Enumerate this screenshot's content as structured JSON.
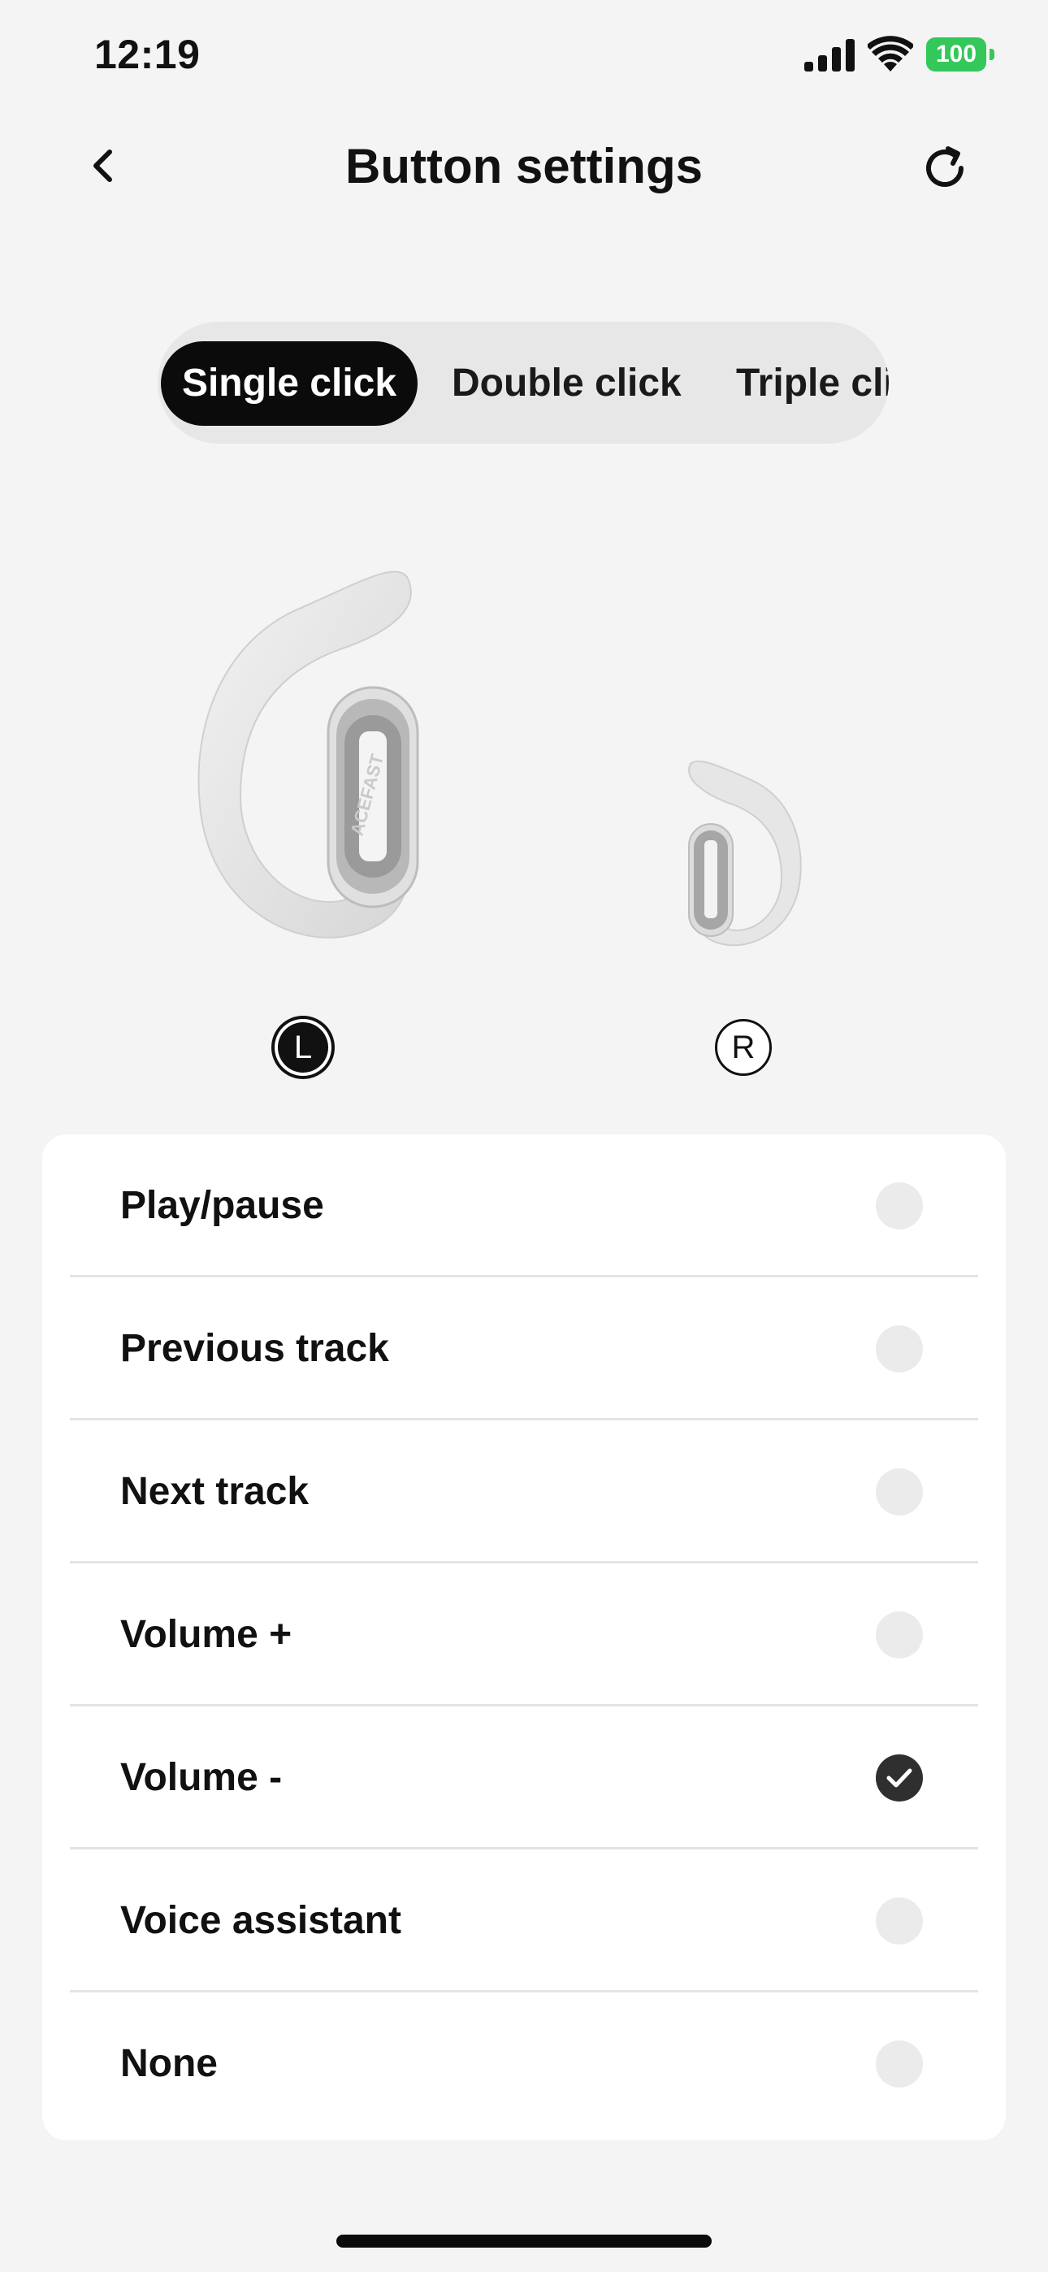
{
  "status_bar": {
    "time": "12:19",
    "battery_level": "100",
    "battery_color": "#34c759",
    "icons": [
      "signal-icon",
      "wifi-icon",
      "battery-icon"
    ]
  },
  "header": {
    "title": "Button settings",
    "back_icon": "chevron-left-icon",
    "refresh_icon": "refresh-icon"
  },
  "tabs": [
    {
      "label": "Single click",
      "selected": true
    },
    {
      "label": "Double click",
      "selected": false
    },
    {
      "label": "Triple click",
      "selected": false
    }
  ],
  "earbuds": {
    "left_badge": "L",
    "right_badge": "R",
    "selected": "L",
    "brand": "ACEFAST"
  },
  "options": [
    {
      "label": "Play/pause",
      "checked": false
    },
    {
      "label": "Previous track",
      "checked": false
    },
    {
      "label": "Next track",
      "checked": false
    },
    {
      "label": "Volume +",
      "checked": false
    },
    {
      "label": "Volume -",
      "checked": true
    },
    {
      "label": "Voice assistant",
      "checked": false
    },
    {
      "label": "None",
      "checked": false
    }
  ]
}
